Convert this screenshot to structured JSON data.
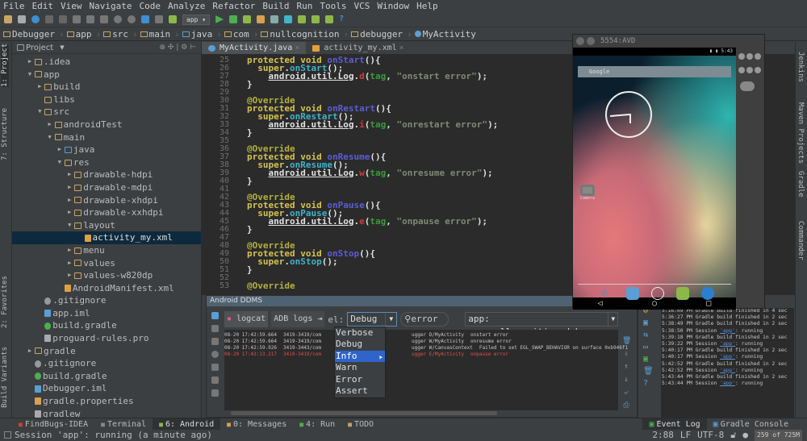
{
  "menu": [
    "File",
    "Edit",
    "View",
    "Navigate",
    "Code",
    "Analyze",
    "Refactor",
    "Build",
    "Run",
    "Tools",
    "VCS",
    "Window",
    "Help"
  ],
  "toolbar": {
    "run_config": "app"
  },
  "breadcrumb": [
    "Debugger",
    "app",
    "src",
    "main",
    "java",
    "com",
    "nullcognition",
    "debugger",
    "MyActivity"
  ],
  "left_strip": {
    "project": "1: Project",
    "structure": "7: Structure",
    "favorites": "2: Favorites",
    "build_variants": "Build Variants"
  },
  "right_strip": {
    "jenkins": "Jenkins",
    "maven": "Maven Projects",
    "gradle": "Gradle",
    "commander": "Commander"
  },
  "project": {
    "header": "Project",
    "tree": [
      {
        "level": 0,
        "arrow": "closed",
        "icon": "folder",
        "label": ".idea"
      },
      {
        "level": 0,
        "arrow": "open",
        "icon": "module",
        "label": "app"
      },
      {
        "level": 1,
        "arrow": "closed",
        "icon": "folder",
        "label": "build"
      },
      {
        "level": 1,
        "arrow": "",
        "icon": "folder",
        "label": "libs"
      },
      {
        "level": 1,
        "arrow": "open",
        "icon": "folder",
        "label": "src"
      },
      {
        "level": 2,
        "arrow": "closed",
        "icon": "folder",
        "label": "androidTest"
      },
      {
        "level": 2,
        "arrow": "open",
        "icon": "folder",
        "label": "main"
      },
      {
        "level": 3,
        "arrow": "closed",
        "icon": "src",
        "label": "java"
      },
      {
        "level": 3,
        "arrow": "open",
        "icon": "res",
        "label": "res"
      },
      {
        "level": 4,
        "arrow": "closed",
        "icon": "folder",
        "label": "drawable-hdpi"
      },
      {
        "level": 4,
        "arrow": "closed",
        "icon": "folder",
        "label": "drawable-mdpi"
      },
      {
        "level": 4,
        "arrow": "closed",
        "icon": "folder",
        "label": "drawable-xhdpi"
      },
      {
        "level": 4,
        "arrow": "closed",
        "icon": "folder",
        "label": "drawable-xxhdpi"
      },
      {
        "level": 4,
        "arrow": "open",
        "icon": "folder",
        "label": "layout"
      },
      {
        "level": 5,
        "arrow": "",
        "icon": "xml",
        "label": "activity_my.xml",
        "selected": true
      },
      {
        "level": 4,
        "arrow": "closed",
        "icon": "folder",
        "label": "menu"
      },
      {
        "level": 4,
        "arrow": "closed",
        "icon": "folder",
        "label": "values"
      },
      {
        "level": 4,
        "arrow": "closed",
        "icon": "folder",
        "label": "values-w820dp"
      },
      {
        "level": 3,
        "arrow": "",
        "icon": "xml",
        "label": "AndroidManifest.xml"
      },
      {
        "level": 1,
        "arrow": "",
        "icon": "git",
        "label": ".gitignore"
      },
      {
        "level": 1,
        "arrow": "",
        "icon": "iml",
        "label": "app.iml"
      },
      {
        "level": 1,
        "arrow": "",
        "icon": "gradle",
        "label": "build.gradle"
      },
      {
        "level": 1,
        "arrow": "",
        "icon": "file",
        "label": "proguard-rules.pro"
      },
      {
        "level": 0,
        "arrow": "closed",
        "icon": "folder",
        "label": "gradle"
      },
      {
        "level": 0,
        "arrow": "",
        "icon": "git",
        "label": ".gitignore"
      },
      {
        "level": 0,
        "arrow": "",
        "icon": "gradle",
        "label": "build.gradle"
      },
      {
        "level": 0,
        "arrow": "",
        "icon": "iml",
        "label": "Debugger.iml"
      },
      {
        "level": 0,
        "arrow": "",
        "icon": "props",
        "label": "gradle.properties"
      },
      {
        "level": 0,
        "arrow": "",
        "icon": "file",
        "label": "gradlew"
      }
    ]
  },
  "editor": {
    "tabs": [
      {
        "label": "MyActivity.java",
        "active": true
      },
      {
        "label": "activity_my.xml",
        "active": false
      }
    ],
    "first_line": 25,
    "lines": [
      [
        [
          "kw",
          "protected void "
        ],
        [
          "fn",
          "onStart"
        ],
        [
          "p",
          "(){"
        ]
      ],
      [
        [
          "p",
          "  "
        ],
        [
          "kw",
          "super"
        ],
        [
          "p",
          "."
        ],
        [
          "call",
          "onStart"
        ],
        [
          "p",
          "();"
        ]
      ],
      [
        [
          "p",
          "    "
        ],
        [
          "log",
          "android.util.Log"
        ],
        [
          "p",
          "."
        ],
        [
          "m",
          "d"
        ],
        [
          "p",
          "("
        ],
        [
          "tag",
          "tag"
        ],
        [
          "p",
          ", "
        ],
        [
          "str",
          "\"onstart error\""
        ],
        [
          "p",
          ");"
        ]
      ],
      [
        [
          "p",
          "}"
        ]
      ],
      [],
      [
        [
          "ann",
          "@Override"
        ]
      ],
      [
        [
          "kw",
          "protected void "
        ],
        [
          "fn",
          "onRestart"
        ],
        [
          "p",
          "(){"
        ]
      ],
      [
        [
          "p",
          "  "
        ],
        [
          "kw",
          "super"
        ],
        [
          "p",
          "."
        ],
        [
          "call",
          "onRestart"
        ],
        [
          "p",
          "();"
        ]
      ],
      [
        [
          "p",
          "    "
        ],
        [
          "log",
          "android.util.Log"
        ],
        [
          "p",
          "."
        ],
        [
          "m",
          "i"
        ],
        [
          "p",
          "("
        ],
        [
          "tag",
          "tag"
        ],
        [
          "p",
          ", "
        ],
        [
          "str",
          "\"onrestart error\""
        ],
        [
          "p",
          ");"
        ]
      ],
      [
        [
          "p",
          "}"
        ]
      ],
      [],
      [
        [
          "ann",
          "@Override"
        ]
      ],
      [
        [
          "kw",
          "protected void "
        ],
        [
          "fn",
          "onResume"
        ],
        [
          "p",
          "(){"
        ]
      ],
      [
        [
          "p",
          "  "
        ],
        [
          "kw",
          "super"
        ],
        [
          "p",
          "."
        ],
        [
          "call",
          "onResume"
        ],
        [
          "p",
          "();"
        ]
      ],
      [
        [
          "p",
          "    "
        ],
        [
          "log",
          "android.util.Log"
        ],
        [
          "p",
          "."
        ],
        [
          "m",
          "w"
        ],
        [
          "p",
          "("
        ],
        [
          "tag",
          "tag"
        ],
        [
          "p",
          ", "
        ],
        [
          "str",
          "\"onresume error\""
        ],
        [
          "p",
          ");"
        ]
      ],
      [
        [
          "p",
          "}"
        ]
      ],
      [],
      [
        [
          "ann",
          "@Override"
        ]
      ],
      [
        [
          "kw",
          "protected void "
        ],
        [
          "fn",
          "onPause"
        ],
        [
          "p",
          "(){"
        ]
      ],
      [
        [
          "p",
          "  "
        ],
        [
          "kw",
          "super"
        ],
        [
          "p",
          "."
        ],
        [
          "call",
          "onPause"
        ],
        [
          "p",
          "();"
        ]
      ],
      [
        [
          "p",
          "    "
        ],
        [
          "log",
          "android.util.Log"
        ],
        [
          "p",
          "."
        ],
        [
          "m",
          "e"
        ],
        [
          "p",
          "("
        ],
        [
          "tag",
          "tag"
        ],
        [
          "p",
          ", "
        ],
        [
          "str",
          "\"onpause error\""
        ],
        [
          "p",
          ");"
        ]
      ],
      [
        [
          "p",
          "}"
        ]
      ],
      [],
      [
        [
          "ann",
          "@Override"
        ]
      ],
      [
        [
          "kw",
          "protected void "
        ],
        [
          "fn",
          "onStop"
        ],
        [
          "p",
          "(){"
        ]
      ],
      [
        [
          "p",
          "  "
        ],
        [
          "kw",
          "super"
        ],
        [
          "p",
          "."
        ],
        [
          "call",
          "onStop"
        ],
        [
          "p",
          "();"
        ]
      ],
      [
        [
          "p",
          "}"
        ]
      ],
      [],
      [
        [
          "ann",
          "@Override"
        ]
      ]
    ]
  },
  "ddms": {
    "title": "Android DDMS",
    "tabs": [
      "logcat",
      "ADB logs"
    ],
    "level_label": "el:",
    "level_value": "Debug",
    "search": "error",
    "app_filter": "app: com.nullcognition.debugger",
    "levels": [
      "Verbose",
      "Debug",
      "Info",
      "Warn",
      "Error",
      "Assert"
    ],
    "highlighted_level": "Info",
    "log": [
      {
        "time": "08-20 17:42:59.664",
        "pid": "3419-3419/com",
        "tag": "ugger D/MyActivity",
        "msg": "onstart error",
        "error": false
      },
      {
        "time": "08-20 17:42:59.664",
        "pid": "3419-3419/com",
        "tag": "ugger W/MyActivity",
        "msg": "onresume error",
        "error": false
      },
      {
        "time": "08-20 17:42:59.926",
        "pid": "3419-3443/com",
        "tag": "ugger W/CanvasContext",
        "msg": "Failed to set EGL_SWAP_BEHAVIOR on surface 0xb946f1",
        "error": false
      },
      {
        "time": "08-20 17:43:13.217",
        "pid": "3419-3419/com",
        "tag": "ugger E/MyActivity",
        "msg": "onpause error",
        "error": true
      }
    ]
  },
  "event_log": [
    {
      "time": "5:16:09 PM",
      "pre": "Gradle build finished in 4 sec"
    },
    {
      "time": "5:36:27 PM",
      "pre": "Gradle build finished in 2 sec"
    },
    {
      "time": "5:38:49 PM",
      "pre": "Gradle build finished in 2 sec"
    },
    {
      "time": "5:38:50 PM",
      "pre": "Session ",
      "link": "'app'",
      "post": ": running"
    },
    {
      "time": "5:39:18 PM",
      "pre": "Gradle build finished in 2 sec"
    },
    {
      "time": "5:39:22 PM",
      "pre": "Session ",
      "link": "'app'",
      "post": ": running"
    },
    {
      "time": "5:40:17 PM",
      "pre": "Gradle build finished in 2 sec"
    },
    {
      "time": "5:40:17 PM",
      "pre": "Session ",
      "link": "'app'",
      "post": ": running"
    },
    {
      "time": "5:42:52 PM",
      "pre": "Gradle build finished in 2 sec"
    },
    {
      "time": "5:42:52 PM",
      "pre": "Session ",
      "link": "'app'",
      "post": ": running"
    },
    {
      "time": "5:43:44 PM",
      "pre": "Gradle build finished in 2 sec"
    },
    {
      "time": "5:43:44 PM",
      "pre": "Session ",
      "link": "'app'",
      "post": ": running"
    }
  ],
  "emulator": {
    "title": "5554:AVD",
    "time": "5:43",
    "search": "Google",
    "app_label": "Camera"
  },
  "bottom_tabs": [
    {
      "label": "FindBugs-IDEA",
      "color": "#d04030"
    },
    {
      "label": "Terminal",
      "color": "#888888"
    },
    {
      "label": "6: Android",
      "color": "#8cb84a",
      "active": true
    },
    {
      "label": "0: Messages",
      "color": "#d8a050"
    },
    {
      "label": "4: Run",
      "color": "#4caf50"
    },
    {
      "label": "TODO",
      "color": "#c8a070"
    }
  ],
  "bottom_right_tabs": [
    "Event Log",
    "Gradle Console"
  ],
  "status": {
    "message": "Session 'app': running (a minute ago)",
    "position": "2:88",
    "line_sep": "LF",
    "encoding": "UTF-8",
    "memory": "259 of 725M"
  }
}
